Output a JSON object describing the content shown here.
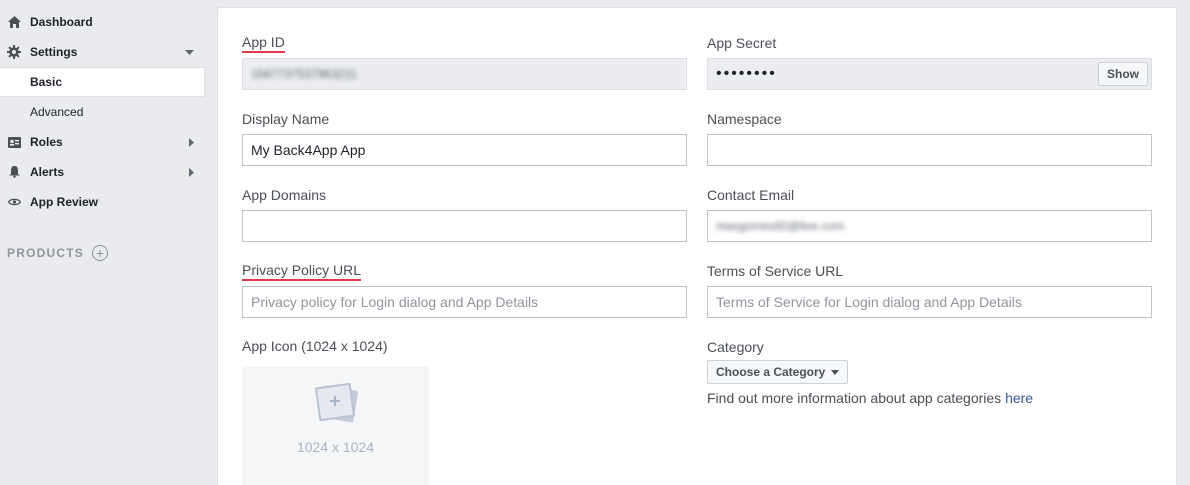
{
  "sidebar": {
    "dashboard": "Dashboard",
    "settings": "Settings",
    "basic": "Basic",
    "advanced": "Advanced",
    "roles": "Roles",
    "alerts": "Alerts",
    "app_review": "App Review",
    "products": "PRODUCTS"
  },
  "form": {
    "app_id": {
      "label": "App ID",
      "value": "1567737537963211"
    },
    "app_secret": {
      "label": "App Secret",
      "value": "••••••••",
      "show_label": "Show"
    },
    "display_name": {
      "label": "Display Name",
      "value": "My Back4App App"
    },
    "namespace": {
      "label": "Namespace",
      "value": ""
    },
    "app_domains": {
      "label": "App Domains",
      "value": ""
    },
    "contact_email": {
      "label": "Contact Email",
      "value": "maxgomes92@live.com"
    },
    "privacy_policy_url": {
      "label": "Privacy Policy URL",
      "placeholder": "Privacy policy for Login dialog and App Details"
    },
    "terms_url": {
      "label": "Terms of Service URL",
      "placeholder": "Terms of Service for Login dialog and App Details"
    },
    "app_icon": {
      "label": "App Icon (1024 x 1024)",
      "size_text": "1024 x 1024"
    },
    "category": {
      "label": "Category",
      "button": "Choose a Category",
      "info_text": "Find out more information about app categories ",
      "info_link": "here"
    }
  },
  "colors": {
    "error_underline": "#e0394a",
    "link": "#365899",
    "background": "#e9ebee"
  }
}
